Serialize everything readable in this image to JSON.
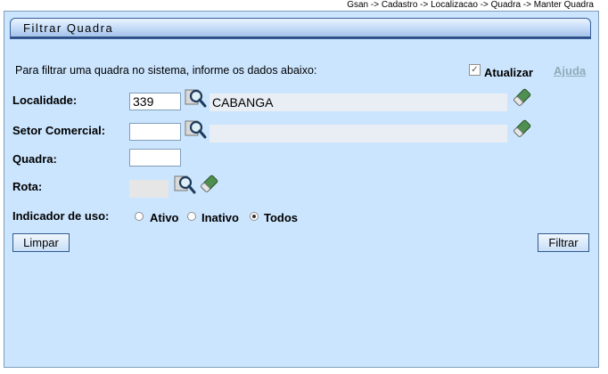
{
  "breadcrumb": "Gsan -> Cadastro -> Localizacao -> Quadra -> Manter Quadra",
  "title": "Filtrar Quadra",
  "intro": "Para filtrar uma quadra no sistema, informe os dados abaixo:",
  "atualizar": {
    "label": "Atualizar",
    "checked": true,
    "check_glyph": "✓"
  },
  "help_label": "Ajuda",
  "fields": {
    "localidade": {
      "label": "Localidade:",
      "code": "339",
      "description": "CABANGA"
    },
    "setor": {
      "label": "Setor Comercial:",
      "code": "",
      "description": ""
    },
    "quadra": {
      "label": "Quadra:",
      "value": ""
    },
    "rota": {
      "label": "Rota:",
      "value": ""
    }
  },
  "indicador": {
    "label": "Indicador de uso:",
    "options": [
      "Ativo",
      "Inativo",
      "Todos"
    ],
    "selected": "Todos"
  },
  "buttons": {
    "clear": "Limpar",
    "filter": "Filtrar"
  },
  "icons": {
    "search": "magnifier-search-icon",
    "erase": "eraser-icon"
  },
  "colors": {
    "panel_bg": "#cbe5fe",
    "title_border": "#3a5f99",
    "button_border": "#2f5b8f",
    "help_link": "#8faab8"
  }
}
